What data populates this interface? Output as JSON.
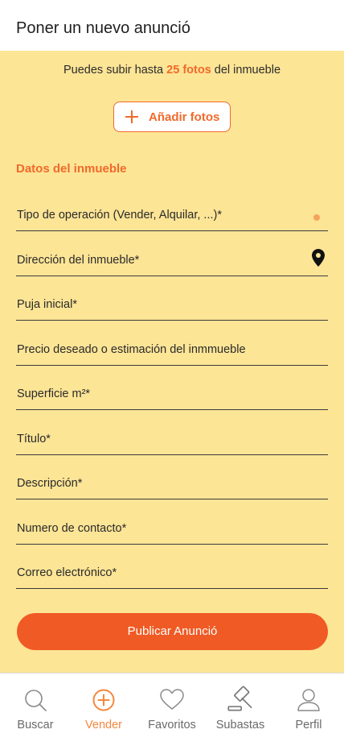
{
  "header": {
    "title": "Poner un nuevo anunció"
  },
  "upload": {
    "info_prefix": "Puedes subir hasta",
    "info_highlight": "25 fotos",
    "info_suffix": "del inmueble",
    "button_label": "Añadir fotos"
  },
  "section": {
    "title": "Datos del inmueble"
  },
  "fields": [
    {
      "label": "Tipo de operación (Vender, Alquilar, ...)*",
      "value": ""
    },
    {
      "label": "Dirección del inmueble*",
      "value": ""
    },
    {
      "label": "Puja inicial*",
      "value": ""
    },
    {
      "label": "Precio deseado o estimación del inmmueble",
      "value": ""
    },
    {
      "label": "Superficie m²*",
      "value": ""
    },
    {
      "label": "Título*",
      "value": ""
    },
    {
      "label": "Descripción*",
      "value": ""
    },
    {
      "label": "Numero de contacto*",
      "value": ""
    },
    {
      "label": "Correo electrónico*",
      "value": ""
    }
  ],
  "publish_label": "Publicar Anunció",
  "tabs": [
    {
      "label": "Buscar",
      "icon": "search-icon",
      "active": false
    },
    {
      "label": "Vender",
      "icon": "plus-circle-icon",
      "active": true
    },
    {
      "label": "Favoritos",
      "icon": "heart-icon",
      "active": false
    },
    {
      "label": "Subastas",
      "icon": "gavel-icon",
      "active": false
    },
    {
      "label": "Perfil",
      "icon": "user-icon",
      "active": false
    }
  ],
  "colors": {
    "accent": "#f06a2b",
    "background": "#fde596",
    "button": "#f05a24",
    "active_tab": "#f5873d",
    "inactive_tab": "#6a6a6a"
  }
}
